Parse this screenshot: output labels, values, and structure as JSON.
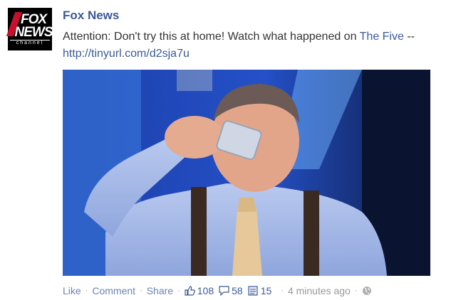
{
  "avatar": {
    "line1": "FOX",
    "line2": "NEWS",
    "line3": "channel"
  },
  "post": {
    "author": "Fox News",
    "message_before": "Attention: Don't try this at home! Watch what happened on ",
    "message_link": "The Five",
    "message_after": " --",
    "url": "http://tinyurl.com/d2sja7u"
  },
  "footer": {
    "like": "Like",
    "comment": "Comment",
    "share": "Share",
    "likes_count": "108",
    "comments_count": "58",
    "shares_count": "15",
    "timestamp": "4 minutes ago",
    "sep": "·"
  },
  "icons": {
    "like": "thumbs-up-icon",
    "comment": "speech-bubble-icon",
    "share": "share-icon",
    "privacy": "globe-icon"
  },
  "colors": {
    "link": "#3b5998",
    "muted": "#6d84b4",
    "brand_red": "#c8102e"
  }
}
